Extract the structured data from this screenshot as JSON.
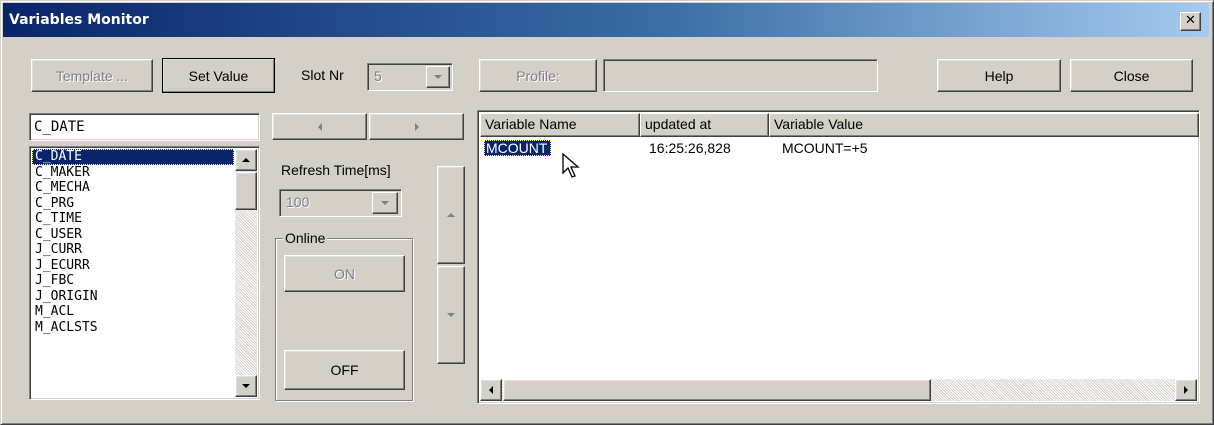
{
  "window": {
    "title": "Variables Monitor",
    "close_glyph": "✕"
  },
  "toolbar": {
    "template_label": "Template ...",
    "set_value_label": "Set Value",
    "slot_label": "Slot Nr",
    "slot_value": "5",
    "profile_label": "Profile:",
    "profile_value": "",
    "help_label": "Help",
    "close_label": "Close"
  },
  "search": {
    "value": "C_DATE"
  },
  "variable_list": {
    "items": [
      "C_DATE",
      "C_MAKER",
      "C_MECHA",
      "C_PRG",
      "C_TIME",
      "C_USER",
      "J_CURR",
      "J_ECURR",
      "J_FBC",
      "J_ORIGIN",
      "M_ACL",
      "M_ACLSTS"
    ],
    "selected_index": 0
  },
  "refresh": {
    "label": "Refresh Time[ms]",
    "value": "100"
  },
  "online": {
    "group_label": "Online",
    "on_label": "ON",
    "off_label": "OFF"
  },
  "table": {
    "columns": [
      "Variable Name",
      "updated at",
      "Variable Value"
    ],
    "rows": [
      {
        "name": "MCOUNT",
        "updated": "16:25:26,828",
        "value": "MCOUNT=+5"
      }
    ]
  },
  "icons": {
    "close": "close-icon",
    "cursor": "mouse-pointer-icon"
  },
  "colors": {
    "selection": "#0a246a",
    "titlebar_start": "#0a246a",
    "titlebar_end": "#a6caf0",
    "face": "#d4d0c8"
  }
}
